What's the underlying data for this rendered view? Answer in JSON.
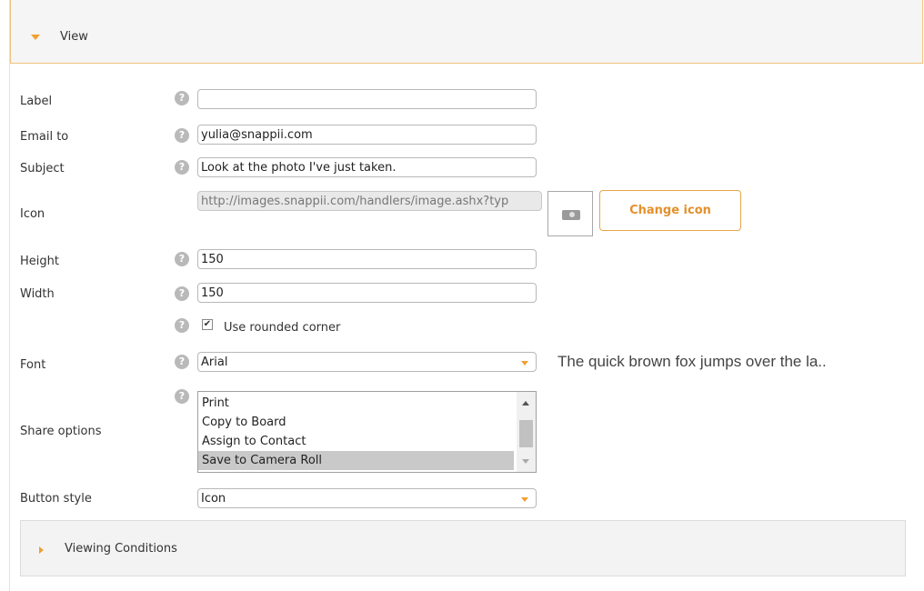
{
  "view_section": {
    "title": "View"
  },
  "form": {
    "label": {
      "label": "Label",
      "value": ""
    },
    "email": {
      "label": "Email to",
      "value": "yulia@snappii.com"
    },
    "subject": {
      "label": "Subject",
      "value": "Look at the photo I've just taken."
    },
    "icon": {
      "label": "Icon",
      "value": "http://images.snappii.com/handlers/image.ashx?typ",
      "button": "Change icon",
      "preview_icon": "camera-icon"
    },
    "height": {
      "label": "Height",
      "value": "150"
    },
    "width": {
      "label": "Width",
      "value": "150"
    },
    "rounded": {
      "label": "Use rounded corner",
      "checked": true
    },
    "font": {
      "label": "Font",
      "value": "Arial",
      "preview": "The quick brown fox jumps over the la.."
    },
    "share": {
      "label": "Share options",
      "options": [
        "Print",
        "Copy to Board",
        "Assign to Contact",
        "Save to Camera Roll"
      ],
      "selected": "Save to Camera Roll"
    },
    "button_style": {
      "label": "Button style",
      "value": "Icon"
    },
    "help_glyph": "?"
  },
  "viewing_conditions": {
    "title": "Viewing Conditions"
  },
  "colors": {
    "accent": "#f0a030",
    "header_border": "#f0c27a",
    "button_text": "#e5902b"
  }
}
